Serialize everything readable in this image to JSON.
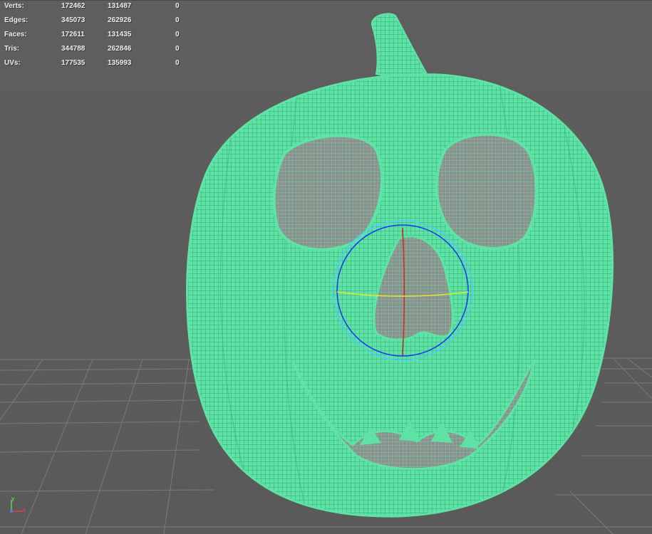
{
  "stats": {
    "rows": [
      {
        "label": "Verts:",
        "total": "172462",
        "selected": "131487",
        "extra": "0"
      },
      {
        "label": "Edges:",
        "total": "345073",
        "selected": "262926",
        "extra": "0"
      },
      {
        "label": "Faces:",
        "total": "172611",
        "selected": "131435",
        "extra": "0"
      },
      {
        "label": "Tris:",
        "total": "344788",
        "selected": "262846",
        "extra": "0"
      },
      {
        "label": "UVs:",
        "total": "177535",
        "selected": "135993",
        "extra": "0"
      }
    ]
  },
  "axis": {
    "x_label": "x",
    "y_label": "y"
  },
  "colors": {
    "viewport_bg": "#5d5d5d",
    "grid_line": "#7a7a7a",
    "mesh_fill": "#5fe3a4",
    "mesh_wire": "#2fa877",
    "manip_blue": "#1a33ff",
    "manip_red": "#c8281e",
    "manip_yellow": "#e8e82e",
    "manip_cyan": "#4fc9ff"
  }
}
